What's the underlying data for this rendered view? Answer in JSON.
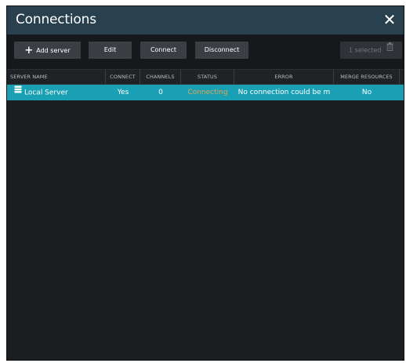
{
  "window": {
    "title": "Connections",
    "close_label": "✕"
  },
  "toolbar": {
    "add_server_label": "Add server",
    "edit_label": "Edit",
    "connect_label": "Connect",
    "disconnect_label": "Disconnect",
    "selected_label": "1 selected"
  },
  "table": {
    "headers": [
      "SERVER NAME",
      "CONNECT",
      "CHANNELS",
      "STATUS",
      "ERROR",
      "MERGE RESOURCES"
    ],
    "rows": [
      {
        "server_name": "Local Server",
        "connect": "Yes",
        "channels": "0",
        "status": "Connecting",
        "error": "No connection could be m",
        "merge_resources": "No",
        "selected": true
      }
    ]
  },
  "colors": {
    "title_bar": "#29404f",
    "selected_row": "#1aa0b4",
    "status_text": "#e0a35a",
    "background": "#1b1e21"
  }
}
